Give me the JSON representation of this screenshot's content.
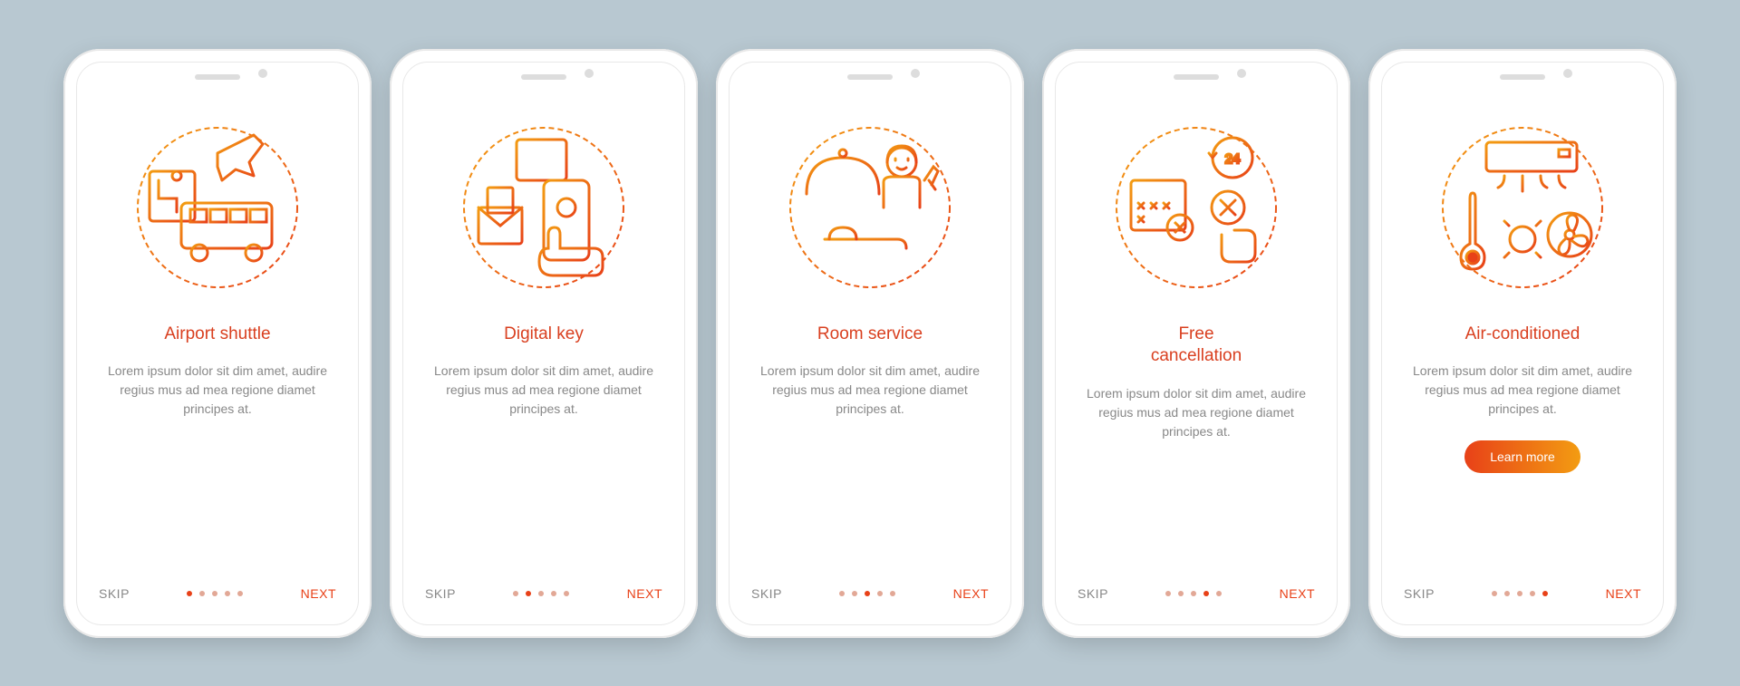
{
  "common": {
    "skip": "SKIP",
    "next": "NEXT",
    "learn_more": "Learn more",
    "lorem": "Lorem ipsum dolor sit dim amet, audire regius mus ad mea regione diamet principes at."
  },
  "screens": [
    {
      "title": "Airport shuttle",
      "icon": "airport-shuttle-icon",
      "active_dot": 0,
      "has_cta": false
    },
    {
      "title": "Digital key",
      "icon": "digital-key-icon",
      "active_dot": 1,
      "has_cta": false
    },
    {
      "title": "Room service",
      "icon": "room-service-icon",
      "active_dot": 2,
      "has_cta": false
    },
    {
      "title": "Free\ncancellation",
      "icon": "free-cancellation-icon",
      "active_dot": 3,
      "has_cta": false
    },
    {
      "title": "Air-conditioned",
      "icon": "air-conditioned-icon",
      "active_dot": 4,
      "has_cta": true
    }
  ],
  "colors": {
    "accent": "#e84118",
    "accent2": "#d94020",
    "gradient_end": "#f39c12",
    "text_muted": "#888",
    "dot_inactive": "#e2a896",
    "bg": "#b8c8d1"
  }
}
